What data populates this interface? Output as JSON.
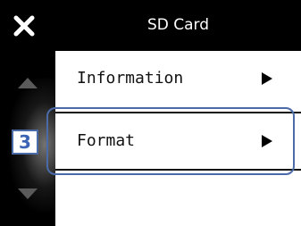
{
  "header": {
    "title": "SD Card",
    "close_icon": "close-icon"
  },
  "sidebar": {
    "scroll_up_icon": "scroll-up-icon",
    "scroll_down_icon": "scroll-down-icon",
    "step_badge": "3"
  },
  "menu": {
    "items": [
      {
        "label": "Information",
        "icon": "play-arrow-icon"
      },
      {
        "label": "Format",
        "icon": "play-arrow-icon"
      }
    ]
  },
  "colors": {
    "background": "#000000",
    "content_background": "#ffffff",
    "highlight": "#4a6aa8",
    "step_badge": "#3c64b4"
  }
}
